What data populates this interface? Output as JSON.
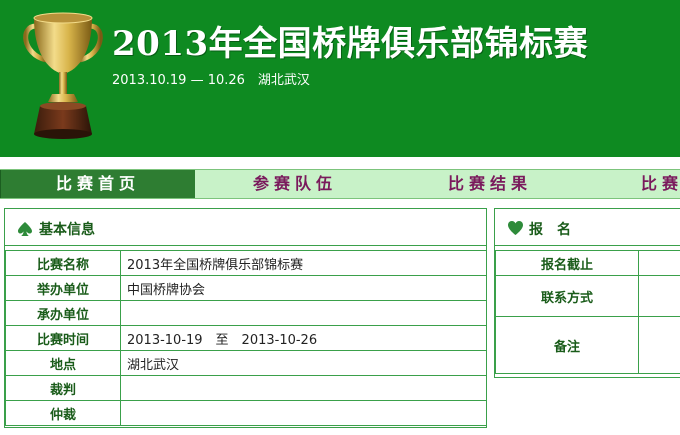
{
  "banner": {
    "title": "2013年全国桥牌俱乐部锦标赛",
    "date_line": "2013.10.19 — 10.26　湖北武汉"
  },
  "nav": {
    "tabs": [
      {
        "label": "比赛首页",
        "active": true
      },
      {
        "label": "参赛队伍",
        "active": false
      },
      {
        "label": "比赛结果",
        "active": false
      },
      {
        "label": "比赛",
        "active": false
      }
    ]
  },
  "basic_info": {
    "header": "基本信息",
    "rows": [
      {
        "key": "比赛名称",
        "value": "2013年全国桥牌俱乐部锦标赛"
      },
      {
        "key": "举办单位",
        "value": "中国桥牌协会"
      },
      {
        "key": "承办单位",
        "value": ""
      },
      {
        "key": "比赛时间",
        "value": "2013-10-19　至　2013-10-26"
      },
      {
        "key": "地点",
        "value": "湖北武汉"
      },
      {
        "key": "裁判",
        "value": ""
      },
      {
        "key": "仲裁",
        "value": ""
      }
    ]
  },
  "registration": {
    "header": "报　名",
    "rows": [
      {
        "key": "报名截止",
        "value": ""
      },
      {
        "key": "联系方式",
        "value": ""
      },
      {
        "key": "备注",
        "value": ""
      }
    ]
  },
  "colors": {
    "banner_green": "#0e8a21",
    "nav_bg": "#c8f2c8",
    "nav_active": "#2e7d32",
    "nav_text": "#7a1a5c",
    "border": "#3aa04a"
  },
  "icons": {
    "banner": "trophy-icon",
    "basic_info": "spade-icon",
    "registration": "heart-icon"
  }
}
